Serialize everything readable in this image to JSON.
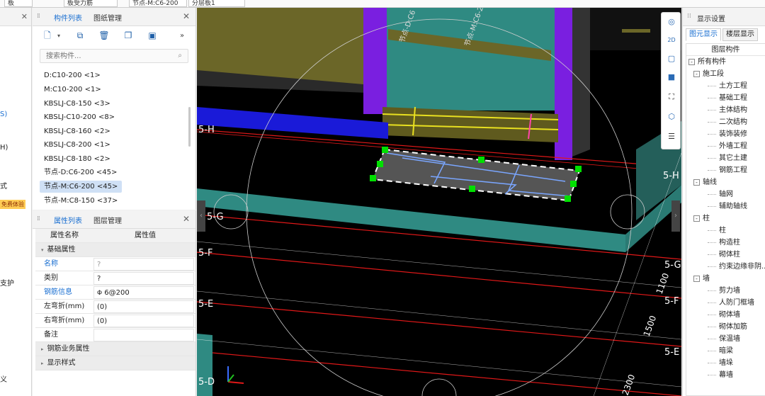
{
  "topbar": {
    "dropdowns": [
      "板",
      "板受力筋",
      "节点-M:C6-200",
      "分层板1"
    ]
  },
  "left_panel": {
    "items": [
      "S)",
      "H)",
      "式",
      "支护",
      "义"
    ],
    "badge": "免费体验"
  },
  "component_panel": {
    "tabs": [
      "构件列表",
      "图纸管理"
    ],
    "search_placeholder": "搜索构件...",
    "items": [
      "D:C10-200 <1>",
      "M:C10-200 <1>",
      "KBSLJ-C8-150 <3>",
      "KBSLJ-C10-200 <8>",
      "KBSLJ-C8-160 <2>",
      "KBSLJ-C8-200 <1>",
      "KBSLJ-C8-180 <2>",
      "节点-D:C6-200 <45>",
      "节点-M:C6-200 <45>",
      "节点-M:C8-150 <37>"
    ],
    "selected_index": 8
  },
  "property_panel": {
    "tabs": [
      "属性列表",
      "图层管理"
    ],
    "columns": [
      "属性名称",
      "属性值"
    ],
    "group_basic": "基础属性",
    "rows": [
      {
        "name": "名称",
        "value": "?"
      },
      {
        "name": "类别",
        "value": "?"
      },
      {
        "name": "钢筋信息",
        "value": " 6@200"
      },
      {
        "name": "左弯折(mm)",
        "value": "(0)"
      },
      {
        "name": "右弯折(mm)",
        "value": "(0)"
      },
      {
        "name": "备注",
        "value": ""
      }
    ],
    "group_rebar": "钢筋业务属性",
    "group_display": "显示样式"
  },
  "viewport": {
    "axis_labels_left": [
      "5-H",
      "5-G",
      "5-F",
      "5-E",
      "5-D"
    ],
    "axis_labels_right": [
      "5-H",
      "5-G",
      "5-F",
      "5-E"
    ],
    "dimensions": [
      "1100",
      "1500",
      "2300"
    ],
    "node_labels": [
      "节点-D:C6",
      "节点-M:C6-2"
    ],
    "tools": [
      "orbit-icon",
      "2d-icon",
      "3d-box-icon",
      "3d-solid-icon",
      "fit-icon",
      "view-cube-icon",
      "layer-display-icon"
    ]
  },
  "display_panel": {
    "title": "显示设置",
    "tabs": [
      "图元显示",
      "楼层显示"
    ],
    "tree_header": "图层构件",
    "tree": [
      {
        "label": "所有构件",
        "level": 0,
        "toggle": "-"
      },
      {
        "label": "施工段",
        "level": 1,
        "toggle": "-"
      },
      {
        "label": "土方工程",
        "level": 2
      },
      {
        "label": "基础工程",
        "level": 2
      },
      {
        "label": "主体结构",
        "level": 2
      },
      {
        "label": "二次结构",
        "level": 2
      },
      {
        "label": "装饰装修",
        "level": 2
      },
      {
        "label": "外墙工程",
        "level": 2
      },
      {
        "label": "其它土建",
        "level": 2
      },
      {
        "label": "钢筋工程",
        "level": 2
      },
      {
        "label": "轴线",
        "level": 1,
        "toggle": "-"
      },
      {
        "label": "轴网",
        "level": 2
      },
      {
        "label": "辅助轴线",
        "level": 2
      },
      {
        "label": "柱",
        "level": 1,
        "toggle": "-"
      },
      {
        "label": "柱",
        "level": 2
      },
      {
        "label": "构造柱",
        "level": 2
      },
      {
        "label": "砌体柱",
        "level": 2
      },
      {
        "label": "约束边缘非阴...",
        "level": 2
      },
      {
        "label": "墙",
        "level": 1,
        "toggle": "-"
      },
      {
        "label": "剪力墙",
        "level": 2
      },
      {
        "label": "人防门框墙",
        "level": 2
      },
      {
        "label": "砌体墙",
        "level": 2
      },
      {
        "label": "砌体加筋",
        "level": 2
      },
      {
        "label": "保温墙",
        "level": 2
      },
      {
        "label": "暗梁",
        "level": 2
      },
      {
        "label": "墙垛",
        "level": 2
      },
      {
        "label": "幕墙",
        "level": 2
      }
    ]
  },
  "colors": {
    "accent": "#1a6fd1",
    "viewport_bg": "#000000",
    "slab": "#3b8f8a",
    "column": "#7a1fe0",
    "axis_red": "#e01818",
    "selected_handle": "#00e000"
  }
}
